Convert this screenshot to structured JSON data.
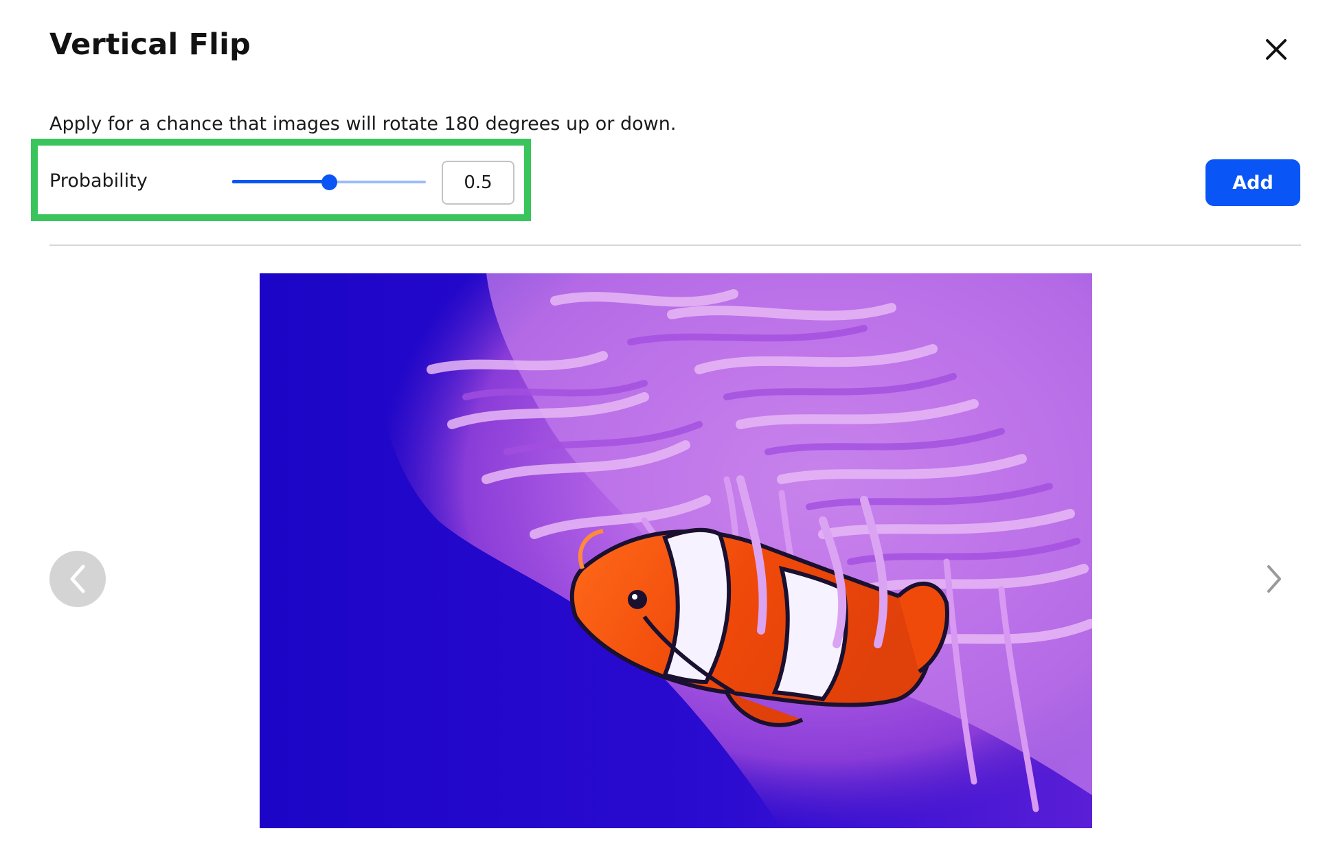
{
  "dialog": {
    "title": "Vertical Flip",
    "description": "Apply for a chance that images will rotate 180 degrees up or down."
  },
  "probability": {
    "label": "Probability",
    "value": "0.5",
    "slider_fraction": 0.5
  },
  "actions": {
    "add_label": "Add"
  },
  "icons": {
    "close": "close-icon",
    "previous": "chevron-left-icon",
    "next": "chevron-right-icon"
  },
  "colors": {
    "accent": "#0a55f5",
    "highlight": "#3ac55c"
  }
}
